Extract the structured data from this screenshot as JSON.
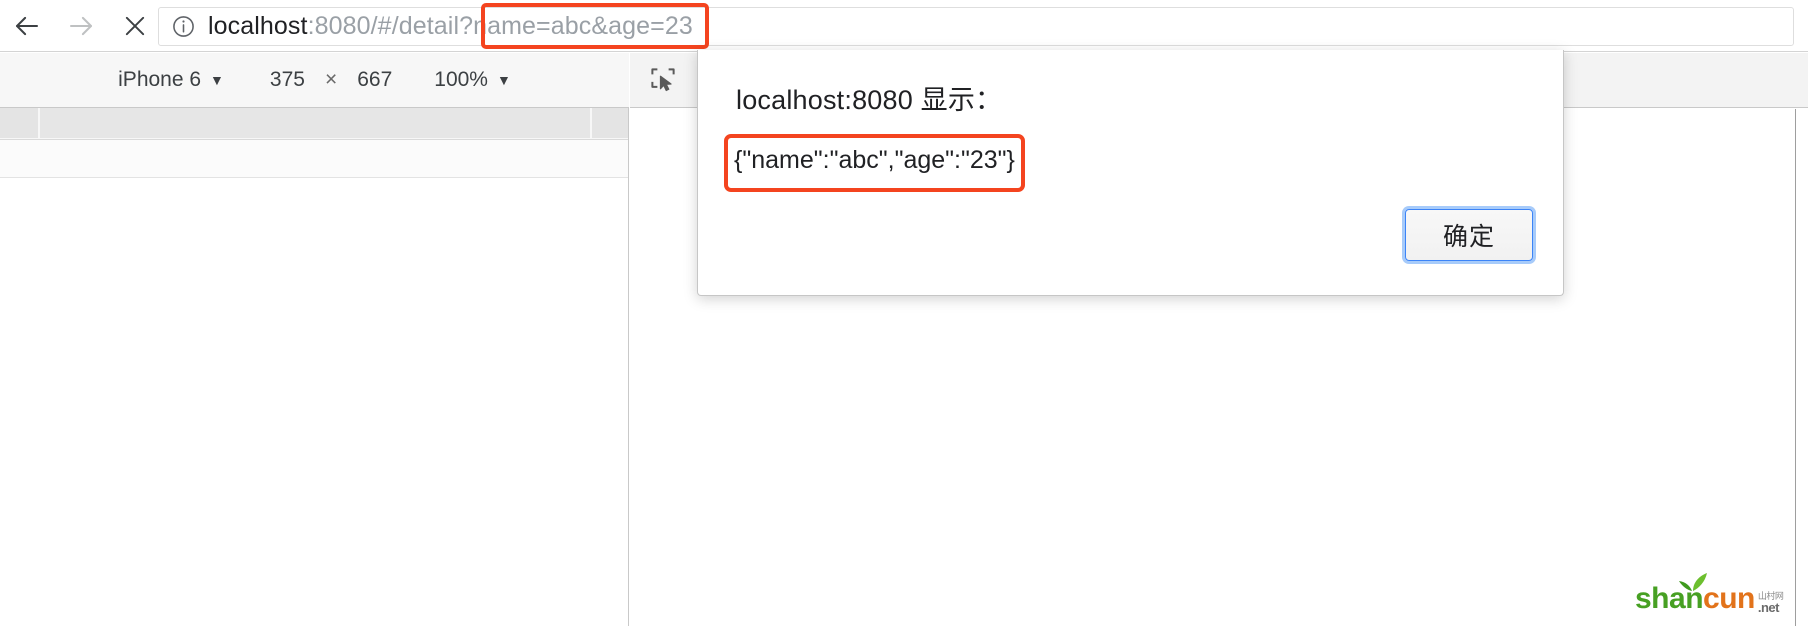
{
  "browser": {
    "nav": {
      "back_label": "Back",
      "forward_label": "Forward",
      "stop_label": "Stop"
    },
    "omnibox": {
      "info_icon": "info-circle-icon",
      "url_host": "localhost",
      "url_rest": ":8080/#/detail?",
      "url_query": "name=abc&age=23",
      "full_url": "localhost:8080/#/detail?name=abc&age=23"
    }
  },
  "device_toolbar": {
    "device": "iPhone 6",
    "width": "375",
    "times": "×",
    "height": "667",
    "zoom": "100%",
    "caret": "▼"
  },
  "devtools": {
    "inspect_icon": "inspect-element-icon",
    "device_toggle_icon": "device-toolbar-icon"
  },
  "dialog": {
    "title": "localhost:8080 显示：",
    "message": "{\"name\":\"abc\",\"age\":\"23\"}",
    "ok_label": "确定"
  },
  "annotations": {
    "highlight_color": "#f4441f",
    "url_query_box": "name=abc&age=23",
    "message_box": "{\"name\":\"abc\",\"age\":\"23\"}"
  },
  "watermark": {
    "brand_first": "shan",
    "brand_second": "cun",
    "cn_text": "山村网",
    "domain": ".net"
  }
}
